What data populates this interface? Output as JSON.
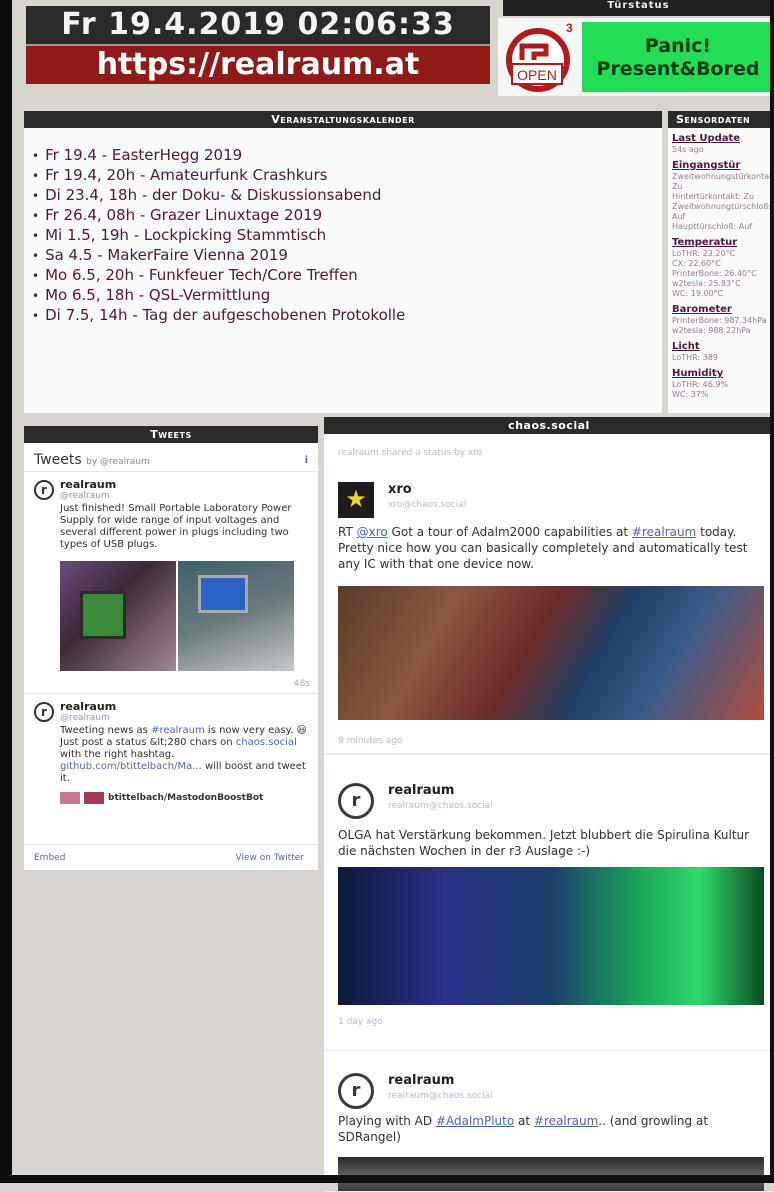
{
  "header": {
    "datetime": "Fr 19.4.2019 02:06:33",
    "url": "https://realraum.at"
  },
  "door_status": {
    "title": "Türstatus",
    "logo_text": "OPEN",
    "logo_superscript": "3",
    "status_line1": "Panic!",
    "status_line2": "Present&Bored"
  },
  "calendar": {
    "title": "Veranstaltungskalender",
    "events": [
      "Fr 19.4 - EasterHegg 2019",
      "Fr 19.4, 20h - Amateurfunk Crashkurs",
      "Di 23.4, 18h - der Doku- & Diskussionsabend",
      "Fr 26.4, 08h - Grazer Linuxtage 2019",
      "Mi 1.5, 19h - Lockpicking Stammtisch",
      "Sa 4.5 - MakerFaire Vienna 2019",
      "Mo 6.5, 20h - Funkfeuer Tech/Core Treffen",
      "Mo 6.5, 18h - QSL-Vermittlung",
      "Di 7.5, 14h - Tag der aufgeschobenen Protokolle"
    ]
  },
  "sensors": {
    "title": "Sensordaten",
    "groups": [
      {
        "heading": "Last Update",
        "values": [
          "54s ago"
        ]
      },
      {
        "heading": "Eingangstür",
        "values": [
          "Zweitwohnungstürkontakt:",
          "Zu",
          "Hintertürkontakt: Zu",
          "Zweitwohnungtürschloß:",
          "Auf",
          "Haupttürschloß: Auf"
        ]
      },
      {
        "heading": "Temperatur",
        "values": [
          "LoTHR: 23.20°C",
          "CX: 22.60°C",
          "PrinterBone: 26.40°C",
          "w2tesla: 25.83°C",
          "WC: 19.00°C"
        ]
      },
      {
        "heading": "Barometer",
        "values": [
          "PrinterBone: 987.34hPa",
          "w2tesla: 988.22hPa"
        ]
      },
      {
        "heading": "Licht",
        "values": [
          "LoTHR: 389"
        ]
      },
      {
        "heading": "Humidity",
        "values": [
          "LoTHR: 46.9%",
          "WC: 37%"
        ]
      }
    ]
  },
  "tweets": {
    "title": "Tweets",
    "widget_title": "Tweets",
    "widget_by": "by @realraum",
    "info_icon": "i",
    "items": [
      {
        "avatar": "r",
        "name": "realraum",
        "handle": "@realraum",
        "text": "Just finished! Small Portable Laboratory Power Supply for wide range of input voltages and several different power in plugs including two types of USB plugs.",
        "time": "48s"
      },
      {
        "avatar": "r",
        "name": "realraum",
        "handle": "@realraum",
        "text_a": "Tweeting news as ",
        "text_link1": "#realraum",
        "text_b": " is now very easy. 😃 Just post a status &lt;280 chars on ",
        "text_link2": "chaos.social",
        "text_c": " with the right hashtag. ",
        "text_link3": "github.com/btittelbach/Ma...",
        "text_d": " will boost and tweet it.",
        "preview_text": "btittelbach/MastodonBoostBot"
      }
    ],
    "embed": "Embed",
    "view_on": "View on Twitter"
  },
  "chaos": {
    "title": "chaos.social",
    "shared_by": "realraum shared a status by xro",
    "posts": [
      {
        "avatar": "★",
        "name": "xro",
        "acct": "xro@chaos.social",
        "text_a": "RT ",
        "mention": "@xro",
        "text_b": " Got a tour of Adalm2000 capabilities at ",
        "hashtag": "#realraum",
        "text_c": " today. Pretty nice how you can basically completely and automatically test any IC with that one device now.",
        "ago": "9 minutes ago"
      },
      {
        "avatar": "r",
        "name": "realraum",
        "acct": "realraum@chaos.social",
        "text": "OLGA hat Verstärkung bekommen. Jetzt blubbert die Spirulina Kultur die nächsten Wochen in der r3 Auslage :-)",
        "ago": "1 day ago"
      },
      {
        "avatar": "r",
        "name": "realraum",
        "acct": "realraum@chaos.social",
        "text_a": "Playing with AD ",
        "hashtag1": "#AdalmPluto",
        "text_b": " at ",
        "hashtag2": "#realraum",
        "text_c": ".. (and growling at SDRangel)"
      }
    ]
  }
}
